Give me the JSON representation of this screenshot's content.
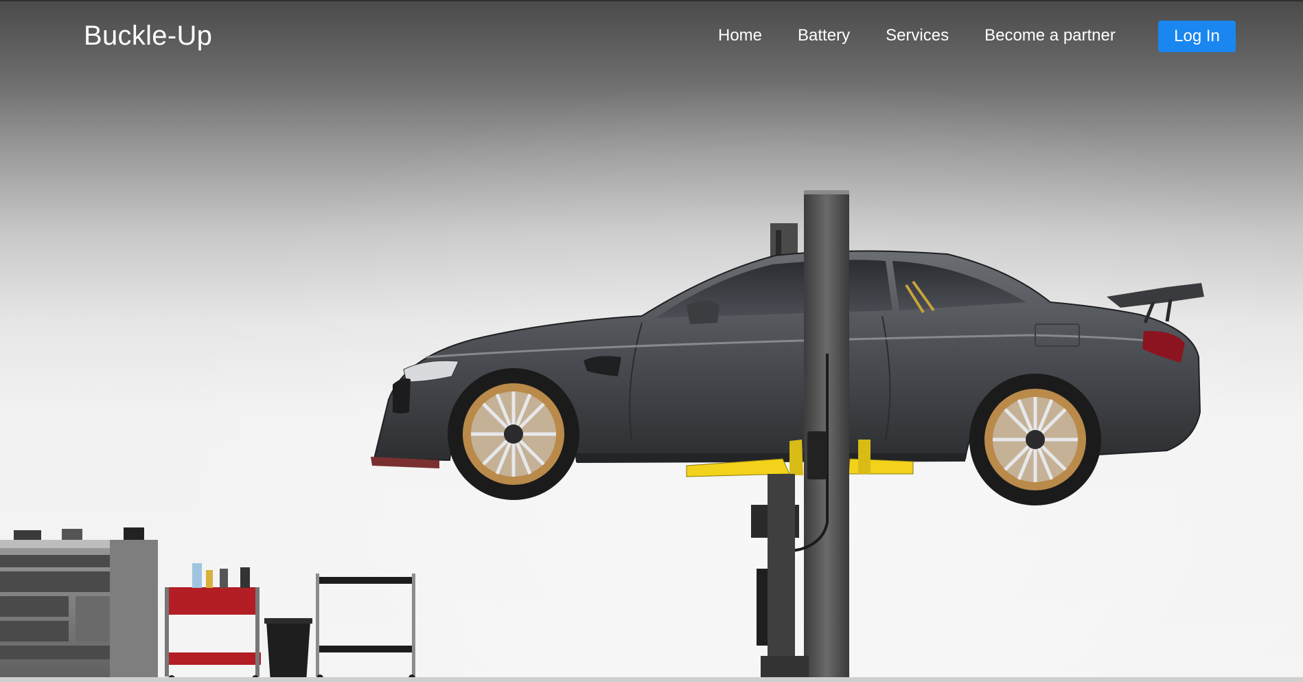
{
  "brand": {
    "name": "Buckle-Up"
  },
  "nav": {
    "items": [
      {
        "label": "Home"
      },
      {
        "label": "Battery"
      },
      {
        "label": "Services"
      },
      {
        "label": "Become a partner"
      }
    ],
    "login_label": "Log In"
  },
  "hero": {
    "image_subject": "grey sports coupe on a two-post car lift in a garage with tool cabinets"
  },
  "colors": {
    "accent": "#1a86f0",
    "nav_text": "#ffffff",
    "lift_arm": "#f2d21b",
    "wheel": "#b98a4a"
  }
}
